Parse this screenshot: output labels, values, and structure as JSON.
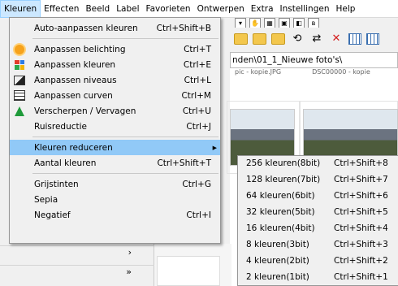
{
  "menubar": {
    "items": [
      "Kleuren",
      "Effecten",
      "Beeld",
      "Label",
      "Favorieten",
      "Ontwerpen",
      "Extra",
      "Instellingen",
      "Help"
    ]
  },
  "path_bar": {
    "text": "nden\\01_1_Nieuwe foto's\\"
  },
  "file_columns": [
    "pic - kopie.JPG",
    "DSC00000 - kopie"
  ],
  "kleuren_menu": {
    "items": [
      {
        "label": "Auto-aanpassen kleuren",
        "shortcut": "Ctrl+Shift+B",
        "icon": ""
      },
      {
        "label": "Aanpassen belichting",
        "shortcut": "Ctrl+T",
        "icon": "exposure-icon"
      },
      {
        "label": "Aanpassen kleuren",
        "shortcut": "Ctrl+E",
        "icon": "color-adjust-icon"
      },
      {
        "label": "Aanpassen niveaus",
        "shortcut": "Ctrl+L",
        "icon": "levels-icon"
      },
      {
        "label": "Aanpassen curven",
        "shortcut": "Ctrl+M",
        "icon": "curves-icon"
      },
      {
        "label": "Verscherpen / Vervagen",
        "shortcut": "Ctrl+U",
        "icon": "sharpen-icon"
      },
      {
        "label": "Ruisreductie",
        "shortcut": "Ctrl+J",
        "icon": ""
      },
      {
        "label": "Kleuren reduceren",
        "shortcut": "",
        "icon": "",
        "submenu": true
      },
      {
        "label": "Aantal kleuren",
        "shortcut": "Ctrl+Shift+T",
        "icon": ""
      },
      {
        "label": "Grijstinten",
        "shortcut": "Ctrl+G",
        "icon": ""
      },
      {
        "label": "Sepia",
        "shortcut": "",
        "icon": ""
      },
      {
        "label": "Negatief",
        "shortcut": "Ctrl+I",
        "icon": ""
      }
    ],
    "highlighted": "Kleuren reduceren"
  },
  "reduce_submenu": {
    "items": [
      {
        "label": "256 kleuren(8bit)",
        "shortcut": "Ctrl+Shift+8"
      },
      {
        "label": "128 kleuren(7bit)",
        "shortcut": "Ctrl+Shift+7"
      },
      {
        "label": "64 kleuren(6bit)",
        "shortcut": "Ctrl+Shift+6"
      },
      {
        "label": "32 kleuren(5bit)",
        "shortcut": "Ctrl+Shift+5"
      },
      {
        "label": "16 kleuren(4bit)",
        "shortcut": "Ctrl+Shift+4"
      },
      {
        "label": "8 kleuren(3bit)",
        "shortcut": "Ctrl+Shift+3"
      },
      {
        "label": "4 kleuren(2bit)",
        "shortcut": "Ctrl+Shift+2"
      },
      {
        "label": "2 kleuren(1bit)",
        "shortcut": "Ctrl+Shift+1"
      }
    ]
  },
  "colors": {
    "menu_highlight": "#91c9f7",
    "menubar_active": "#cce8ff"
  }
}
